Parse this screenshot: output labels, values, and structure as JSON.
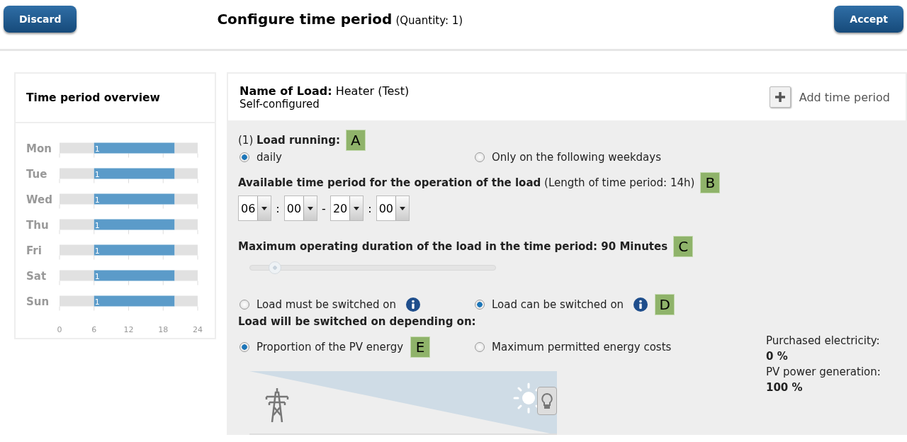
{
  "header": {
    "discard": "Discard",
    "title": "Configure time period",
    "subtitle": "(Quantity: 1)",
    "accept": "Accept"
  },
  "overview": {
    "title": "Time period overview",
    "chart_data": {
      "type": "bar",
      "orientation": "horizontal",
      "stacked": true,
      "categories": [
        "Mon",
        "Tue",
        "Wed",
        "Thu",
        "Fri",
        "Sat",
        "Sun"
      ],
      "series": [
        {
          "color": "#e1e1e1",
          "values": [
            6,
            6,
            6,
            6,
            6,
            6,
            6
          ]
        },
        {
          "name": "1",
          "color": "#5b9bc9",
          "values": [
            14,
            14,
            14,
            14,
            14,
            14,
            14
          ]
        },
        {
          "color": "#e1e1e1",
          "values": [
            4,
            4,
            4,
            4,
            4,
            4,
            4
          ]
        }
      ],
      "xlim": [
        0,
        24
      ],
      "xticks": [
        0,
        6,
        12,
        18,
        24
      ]
    }
  },
  "load": {
    "label": "Name of Load:",
    "name": "Heater (Test)",
    "note": "Self-configured",
    "add_button": "Add time period"
  },
  "running": {
    "prefix": "(1)",
    "label": "Load running:",
    "marker": "A",
    "options": [
      {
        "label": "daily",
        "selected": true
      },
      {
        "label": "Only on the following weekdays",
        "selected": false
      }
    ]
  },
  "period": {
    "label": "Available time period for the operation of the load",
    "note": "(Length of time period: 14h)",
    "marker": "B",
    "selects": [
      "06",
      "00",
      "20",
      "00"
    ],
    "separators": [
      ":",
      "-",
      ":"
    ]
  },
  "duration": {
    "label": "Maximum operating duration of the load in the time period: 90 Minutes",
    "marker": "C",
    "level": 0.1
  },
  "switching": {
    "options": [
      {
        "label": "Load must be switched on",
        "selected": false
      },
      {
        "label": "Load can be switched on",
        "selected": true,
        "marker": "D"
      }
    ]
  },
  "depending": {
    "label": "Load will be switched on depending on:",
    "options": [
      {
        "label": "Proportion of the PV energy",
        "selected": true,
        "marker": "E"
      },
      {
        "label": "Maximum permitted energy costs",
        "selected": false
      }
    ]
  },
  "energy": {
    "level": 1,
    "stats": [
      {
        "label": "Purchased electricity:",
        "value": "0 %"
      },
      {
        "label": "PV power generation:",
        "value": "100 %"
      }
    ]
  }
}
